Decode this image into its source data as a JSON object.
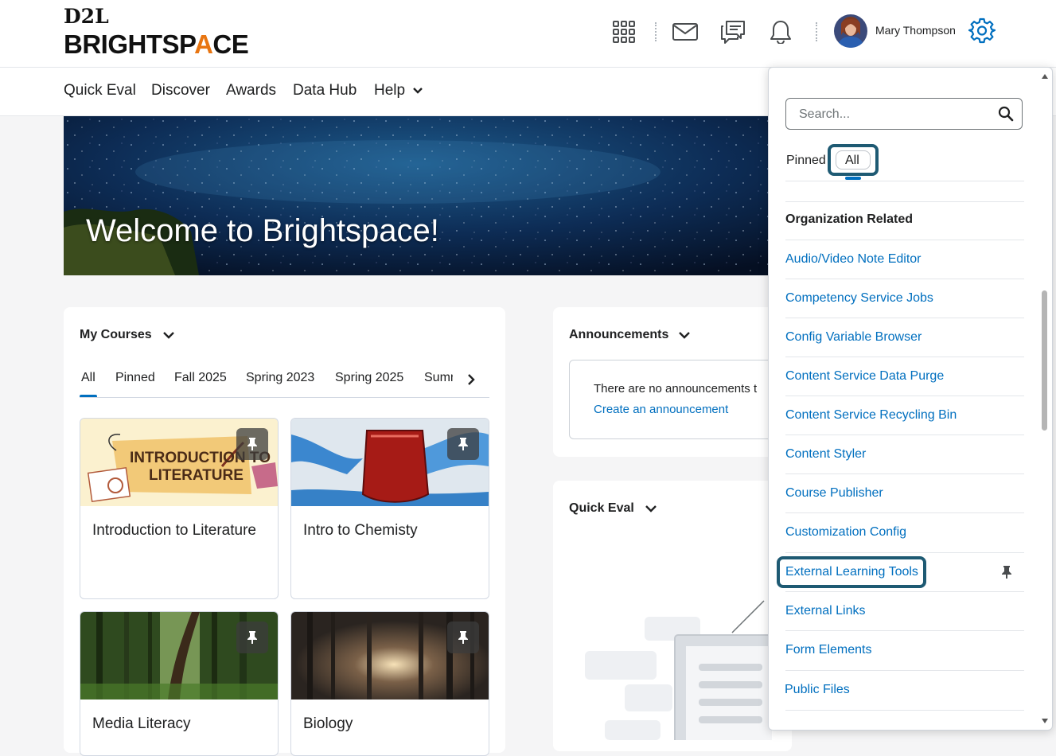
{
  "header": {
    "logo_top": "D2L",
    "logo_bottom_a": "BRIGHTSP",
    "logo_bottom_accent": "A",
    "logo_bottom_b": "CE",
    "user_name": "Mary Thompson"
  },
  "nav": {
    "items": [
      "Quick Eval",
      "Discover",
      "Awards",
      "Data Hub",
      "Help"
    ]
  },
  "banner": {
    "title": "Welcome to Brightspace!"
  },
  "my_courses": {
    "title": "My Courses",
    "tabs": [
      "All",
      "Pinned",
      "Fall 2025",
      "Spring 2023",
      "Spring 2025",
      "Summ"
    ],
    "active_tab": "All",
    "courses": [
      {
        "name": "Introduction to Literature",
        "image_text_1": "INTRODUCTION TO",
        "image_text_2": "LITERATURE"
      },
      {
        "name": "Intro to Chemisty"
      },
      {
        "name": "Media Literacy"
      },
      {
        "name": "Biology"
      }
    ]
  },
  "announcements": {
    "title": "Announcements",
    "empty_text": "There are no announcements t",
    "create_link": "Create an announcement"
  },
  "quick_eval": {
    "title": "Quick Eval"
  },
  "admin_panel": {
    "search_placeholder": "Search...",
    "filters": [
      "Pinned",
      "All"
    ],
    "active_filter": "All",
    "group_heading": "Organization Related",
    "links": [
      "Audio/Video Note Editor",
      "Competency Service Jobs",
      "Config Variable Browser",
      "Content Service Data Purge",
      "Content Service Recycling Bin",
      "Content Styler",
      "Course Publisher",
      "Customization Config",
      "External Learning Tools",
      "External Links",
      "Form Elements",
      "Public Files"
    ],
    "highlighted_link": "External Learning Tools"
  },
  "colors": {
    "link": "#006fbf",
    "highlight_ring": "#1e5a73",
    "active_tab": "#006fbf",
    "logo_accent": "#e87511"
  }
}
